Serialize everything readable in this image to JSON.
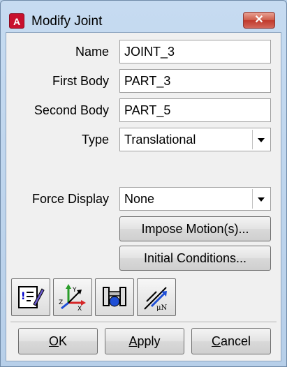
{
  "window": {
    "title": "Modify Joint",
    "app_icon_letter": "A",
    "close_glyph": "✕"
  },
  "form": {
    "name": {
      "label": "Name",
      "value": "JOINT_3"
    },
    "first_body": {
      "label": "First Body",
      "value": "PART_3"
    },
    "second_body": {
      "label": "Second Body",
      "value": "PART_5"
    },
    "type": {
      "label": "Type",
      "value": "Translational"
    },
    "force_display": {
      "label": "Force Display",
      "value": "None"
    }
  },
  "buttons": {
    "impose_motion": "Impose Motion(s)...",
    "initial_conditions": "Initial Conditions...",
    "ok": {
      "mnemonic": "O",
      "rest": "K"
    },
    "apply": {
      "mnemonic": "A",
      "rest": "pply"
    },
    "cancel": {
      "mnemonic": "C",
      "rest": "ancel"
    }
  },
  "icon_toolbar": {
    "icons": [
      "comments-edit-icon",
      "coordinate-axes-icon",
      "joint-primitive-icon",
      "friction-icon"
    ],
    "axis_labels": {
      "x": "X",
      "y": "Y",
      "z": "Z"
    },
    "friction_label": "μN"
  },
  "colors": {
    "title_bg": "#b9d1ea",
    "close": "#c0392b",
    "app_icon": "#c8102e"
  }
}
